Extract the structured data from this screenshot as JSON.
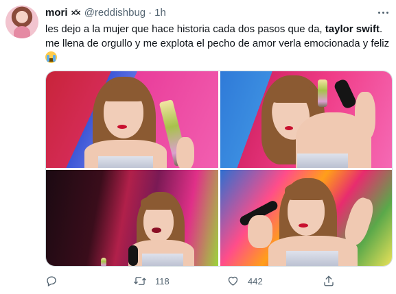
{
  "tweet": {
    "author_name": "mori",
    "author_emoji": "×᷄×",
    "handle": "@reddishbug",
    "separator": "·",
    "time": "1h",
    "text_part1": "les dejo a la mujer que hace historia cada dos pasos que da, ",
    "text_bold": "taylor swift",
    "text_part2": ". me llena de orgullo y me explota el pecho de amor verla emocionada y feliz ",
    "text_emoji_icon": "loudly-crying-face-emoji"
  },
  "media": {
    "photo_count": 4
  },
  "actions": {
    "reply_count": "",
    "retweet_count": "118",
    "like_count": "442",
    "icons": [
      "reply-icon",
      "retweet-icon",
      "like-icon",
      "share-icon"
    ]
  },
  "colors": {
    "text": "#0f1419",
    "secondary": "#536471",
    "border": "#cfd9de",
    "background": "#ffffff"
  }
}
